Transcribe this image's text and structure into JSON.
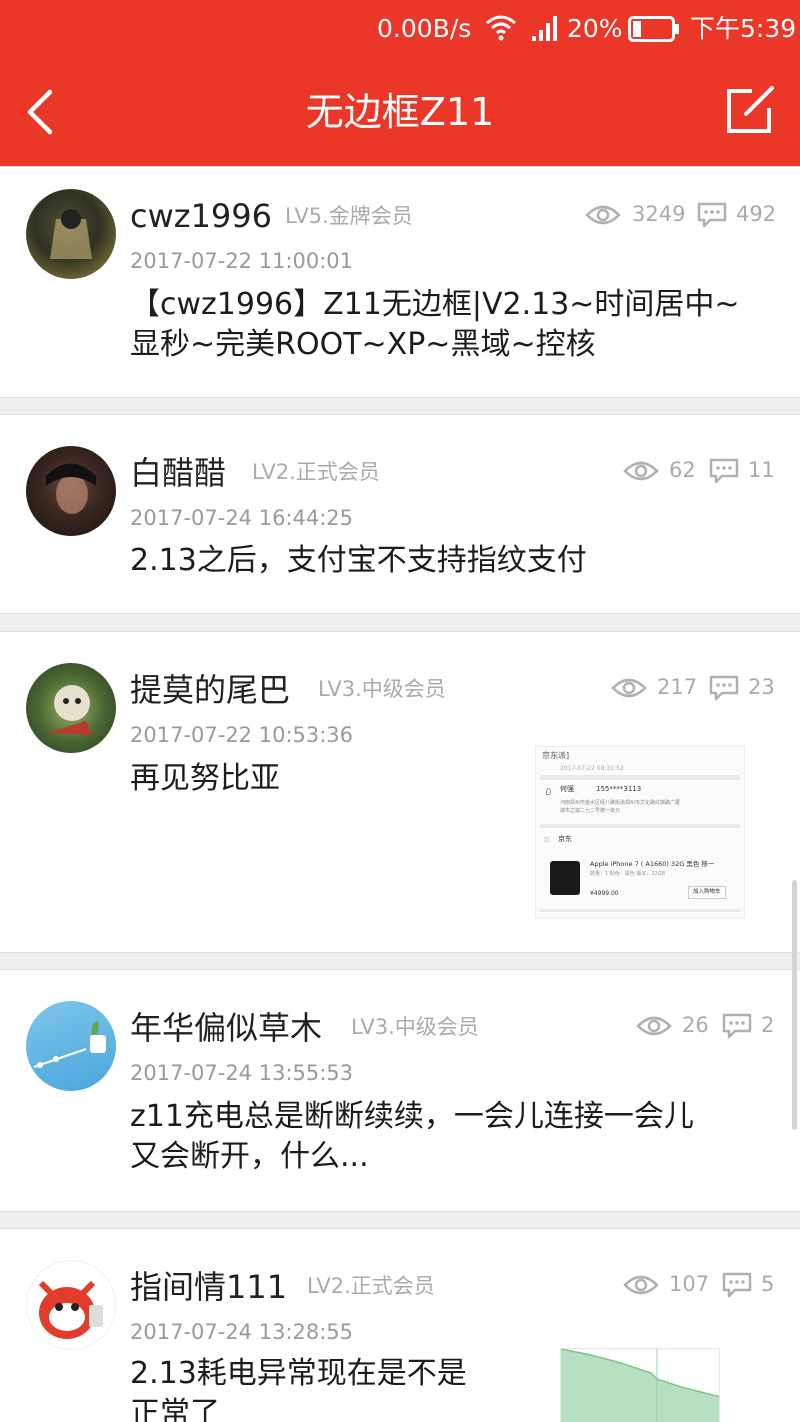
{
  "status_bar": {
    "net_speed": "0.00B/s",
    "battery": "20%",
    "time": "下午5:39"
  },
  "header": {
    "title": "无边框Z11"
  },
  "posts": [
    {
      "author": "cwz1996",
      "level": "LV5.金牌会员",
      "date": "2017-07-22 11:00:01",
      "views": "3249",
      "comments": "492",
      "title_lines": [
        "【cwz1996】Z11无边框|V2.13~时间居中~",
        "显秒~完美ROOT~XP~黑域~控核"
      ]
    },
    {
      "author": "白醋醋",
      "level": "LV2.正式会员",
      "date": "2017-07-24 16:44:25",
      "views": "62",
      "comments": "11",
      "title_lines": [
        "2.13之后，支付宝不支持指纹支付"
      ]
    },
    {
      "author": "提莫的尾巴",
      "level": "LV3.中级会员",
      "date": "2017-07-22 10:53:36",
      "views": "217",
      "comments": "23",
      "title_lines": [
        "再见努比亚"
      ],
      "thumbnail": {
        "store": "京东派]",
        "time": "2017-07-22 08:31:52",
        "recipient": "何强",
        "phone": "155****3113",
        "address_1": "河南郑州市金水区经八路街道郑州市文化路红旗路广厦",
        "address_2": "城市之窗二七二号楼一单元",
        "shop": "京东",
        "product": "Apple iPhone 7 ( A1660) 32G 黑色 移一",
        "spec": "数量：1 颜色：黑色 版本：32GB",
        "price": "¥4999.00",
        "cart": "加入购物车"
      }
    },
    {
      "author": "年华偏似草木",
      "level": "LV3.中级会员",
      "date": "2017-07-24 13:55:53",
      "views": "26",
      "comments": "2",
      "title_lines": [
        "z11充电总是断断续续，一会儿连接一会儿",
        "又会断开，什么..."
      ]
    },
    {
      "author": "指间情111",
      "level": "LV2.正式会员",
      "date": "2017-07-24 13:28:55",
      "views": "107",
      "comments": "5",
      "title_lines": [
        "2.13耗电异常现在是不是",
        "正常了"
      ]
    }
  ],
  "colors": {
    "accent": "#ea3728"
  }
}
